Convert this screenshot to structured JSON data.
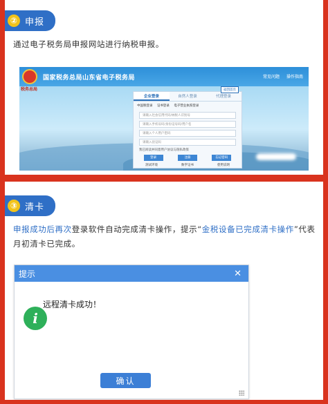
{
  "section1": {
    "number": "②",
    "title": "申报",
    "paragraph": "通过电子税务局申报网站进行纳税申报。"
  },
  "website": {
    "emblem_text": "税务总局",
    "site_name": "国家税务总局山东省电子税务局",
    "top_links": [
      "常见问题",
      "操作指南"
    ],
    "return_link": "返回首页",
    "tabs": [
      "企业登录",
      "自然人登录",
      "代理登录"
    ],
    "sub_tabs": [
      "中国税登录",
      "证书登录",
      "电子营业执照登录"
    ],
    "fields": [
      "请输入社会信用代码/纳税人识别号",
      "请输入手机号码/身份证号码/用户名",
      "请输入个人用户密码",
      "请输入验证码"
    ],
    "checkbox": "我已阅读并同意用户协议与隐私政策",
    "buttons": [
      "登录",
      "注册",
      "忘记密码"
    ],
    "footer_links": [
      "测试环境",
      "数字证书",
      "使用说明"
    ]
  },
  "section2": {
    "number": "③",
    "title": "清卡",
    "para_highlight1": "申报成功后再次",
    "para_text1": "登录软件自动完成清卡操作，提示“",
    "para_highlight2": "金税设备已完成清卡操作",
    "para_text2": "”代表月初清卡已完成。"
  },
  "dialog": {
    "title": "提示",
    "close": "✕",
    "icon": "info-icon",
    "message": "远程清卡成功！",
    "ok_label": "确认"
  },
  "colors": {
    "frame_red": "#d9331e",
    "header_blue": "#2f6fc6",
    "badge_yellow": "#f2c31a",
    "dialog_blue": "#4a8fe2",
    "info_green": "#2eb05a"
  }
}
